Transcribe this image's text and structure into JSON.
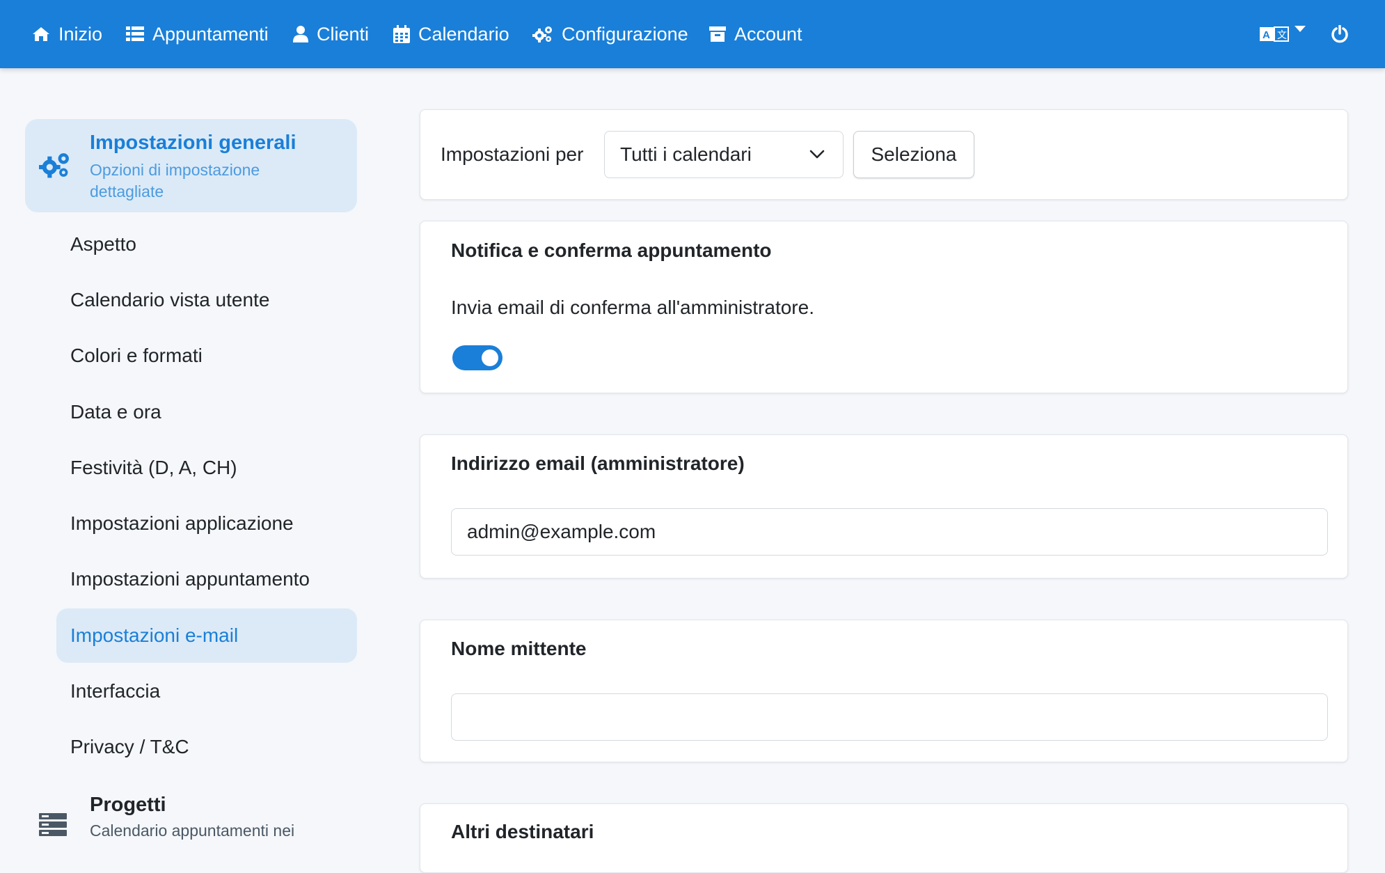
{
  "nav": {
    "items": [
      {
        "label": "Inizio",
        "icon": "home-icon"
      },
      {
        "label": "Appuntamenti",
        "icon": "list-icon"
      },
      {
        "label": "Clienti",
        "icon": "user-icon"
      },
      {
        "label": "Calendario",
        "icon": "calendar-icon"
      },
      {
        "label": "Configurazione",
        "icon": "gears-icon"
      },
      {
        "label": "Account",
        "icon": "archive-icon"
      }
    ],
    "language_icon": "translate-icon",
    "power_icon": "power-icon"
  },
  "sidebar": {
    "header": {
      "title": "Impostazioni generali",
      "subtitle": "Opzioni di impostazione dettagliate"
    },
    "items": [
      {
        "label": "Aspetto"
      },
      {
        "label": "Calendario vista utente"
      },
      {
        "label": "Colori e formati"
      },
      {
        "label": "Data e ora"
      },
      {
        "label": "Festività (D, A, CH)"
      },
      {
        "label": "Impostazioni applicazione"
      },
      {
        "label": "Impostazioni appuntamento"
      },
      {
        "label": "Impostazioni e-mail",
        "active": true
      },
      {
        "label": "Interfaccia"
      },
      {
        "label": "Privacy / T&C"
      }
    ],
    "projects": {
      "title": "Progetti",
      "subtitle": "Calendario appuntamenti nei"
    }
  },
  "settings_for": {
    "label": "Impostazioni per",
    "selected": "Tutti i calendari",
    "button": "Seleziona"
  },
  "notification": {
    "title": "Notifica e conferma appuntamento",
    "description": "Invia email di conferma all'amministratore.",
    "enabled": true
  },
  "admin_email": {
    "title": "Indirizzo email (amministratore)",
    "value": "admin@example.com"
  },
  "sender_name": {
    "title": "Nome mittente",
    "value": ""
  },
  "other_recipients": {
    "title": "Altri destinatari"
  },
  "colors": {
    "primary": "#1a7fd8",
    "active_bg": "#dceaf7"
  }
}
